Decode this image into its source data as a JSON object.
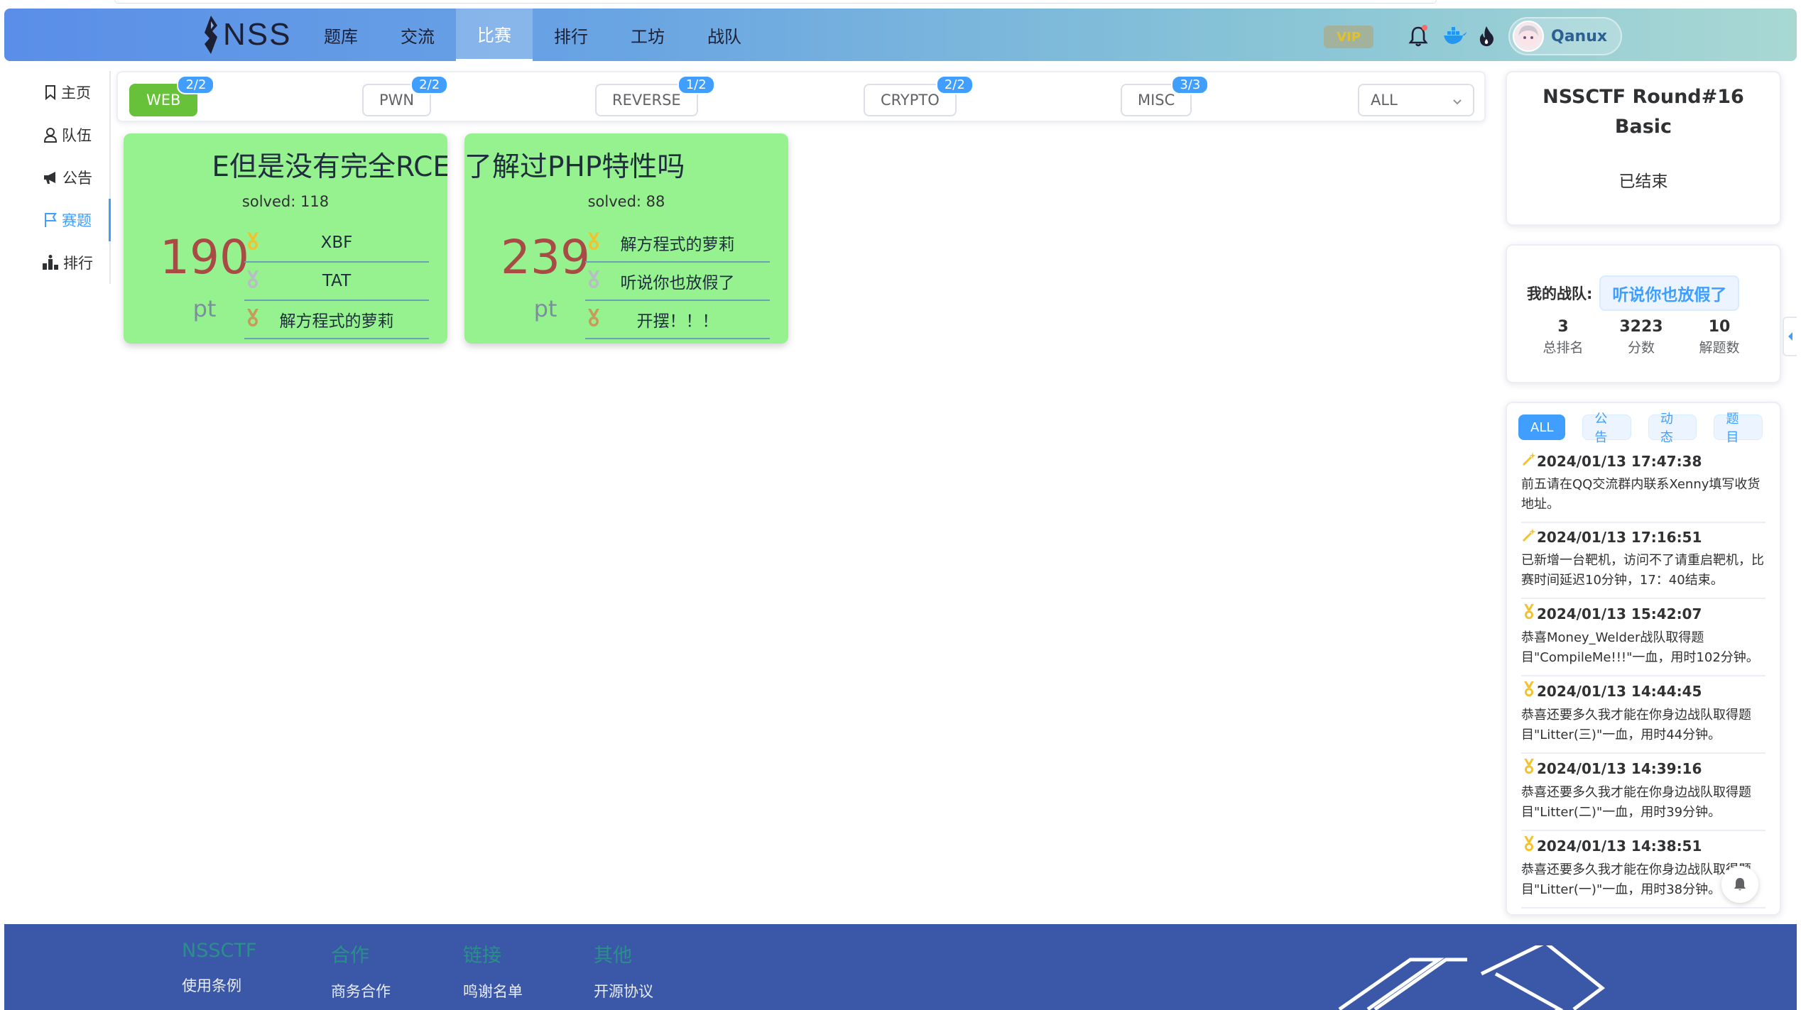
{
  "header": {
    "logo_text": "NSS",
    "nav": [
      "题库",
      "交流",
      "比赛",
      "排行",
      "工坊",
      "战队"
    ],
    "nav_active_index": 2,
    "vip_label": "VIP",
    "user_name": "Qanux"
  },
  "sidebar": {
    "items": [
      {
        "label": "主页",
        "icon": "bookmark-icon"
      },
      {
        "label": "队伍",
        "icon": "user-icon"
      },
      {
        "label": "公告",
        "icon": "megaphone-icon"
      },
      {
        "label": "赛题",
        "icon": "flag-icon",
        "active": true
      },
      {
        "label": "排行",
        "icon": "ranking-icon"
      }
    ]
  },
  "categories": [
    {
      "label": "WEB",
      "badge": "2/2",
      "active": true
    },
    {
      "label": "PWN",
      "badge": "2/2"
    },
    {
      "label": "REVERSE",
      "badge": "1/2"
    },
    {
      "label": "CRYPTO",
      "badge": "2/2"
    },
    {
      "label": "MISC",
      "badge": "3/3"
    }
  ],
  "filter_select": {
    "value": "ALL"
  },
  "challenges": [
    {
      "title": "E但是没有完全RCE",
      "solved": "solved: 118",
      "points": "190",
      "unit": "pt",
      "solvers": [
        "XBF",
        "TAT",
        "解方程式的萝莉"
      ]
    },
    {
      "title": "了解过PHP特性吗",
      "solved": "solved: 88",
      "points": "239",
      "unit": "pt",
      "solvers": [
        "解方程式的萝莉",
        "听说你也放假了",
        "开摆！！！"
      ]
    }
  ],
  "round": {
    "title_line1": "NSSCTF Round#16",
    "title_line2": "Basic",
    "status": "已结束"
  },
  "my_team": {
    "label": "我的战队:",
    "name": "听说你也放假了",
    "stats": [
      {
        "value": "3",
        "label": "总排名"
      },
      {
        "value": "3223",
        "label": "分数"
      },
      {
        "value": "10",
        "label": "解题数"
      }
    ]
  },
  "feed": {
    "tabs": [
      "ALL",
      "公告",
      "动态",
      "题目"
    ],
    "active_tab": 0,
    "items": [
      {
        "icon": "wand-icon",
        "time": "2024/01/13 17:47:38",
        "message": "前五请在QQ交流群内联系Xenny填写收货地址。"
      },
      {
        "icon": "wand-icon",
        "time": "2024/01/13 17:16:51",
        "message": "已新增一台靶机，访问不了请重启靶机，比赛时间延迟10分钟，17：40结束。"
      },
      {
        "icon": "medal-icon",
        "time": "2024/01/13 15:42:07",
        "message": "恭喜Money_Welder战队取得题目\"CompileMe!!!\"一血，用时102分钟。"
      },
      {
        "icon": "medal-icon",
        "time": "2024/01/13 14:44:45",
        "message": "恭喜还要多久我才能在你身边战队取得题目\"Litter(三)\"一血，用时44分钟。"
      },
      {
        "icon": "medal-icon",
        "time": "2024/01/13 14:39:16",
        "message": "恭喜还要多久我才能在你身边战队取得题目\"Litter(二)\"一血，用时39分钟。"
      },
      {
        "icon": "medal-icon",
        "time": "2024/01/13 14:38:51",
        "message": "恭喜还要多久我才能在你身边战队取得题目\"Litter(一)\"一血，用时38分钟。"
      }
    ]
  },
  "footer": {
    "columns": [
      {
        "heading": "NSSCTF",
        "link": "使用条例"
      },
      {
        "heading": "合作",
        "link": "商务合作"
      },
      {
        "heading": "链接",
        "link": "鸣谢名单"
      },
      {
        "heading": "其他",
        "link": "开源协议"
      }
    ]
  },
  "colors": {
    "accent": "#409eff",
    "solved_card": "#95f28f",
    "success": "#67c23a",
    "footer": "#3b58a8",
    "points": "#a94a45",
    "gold": "#f2c230",
    "silver": "#b8bcc4",
    "bronze": "#c99a5b"
  }
}
